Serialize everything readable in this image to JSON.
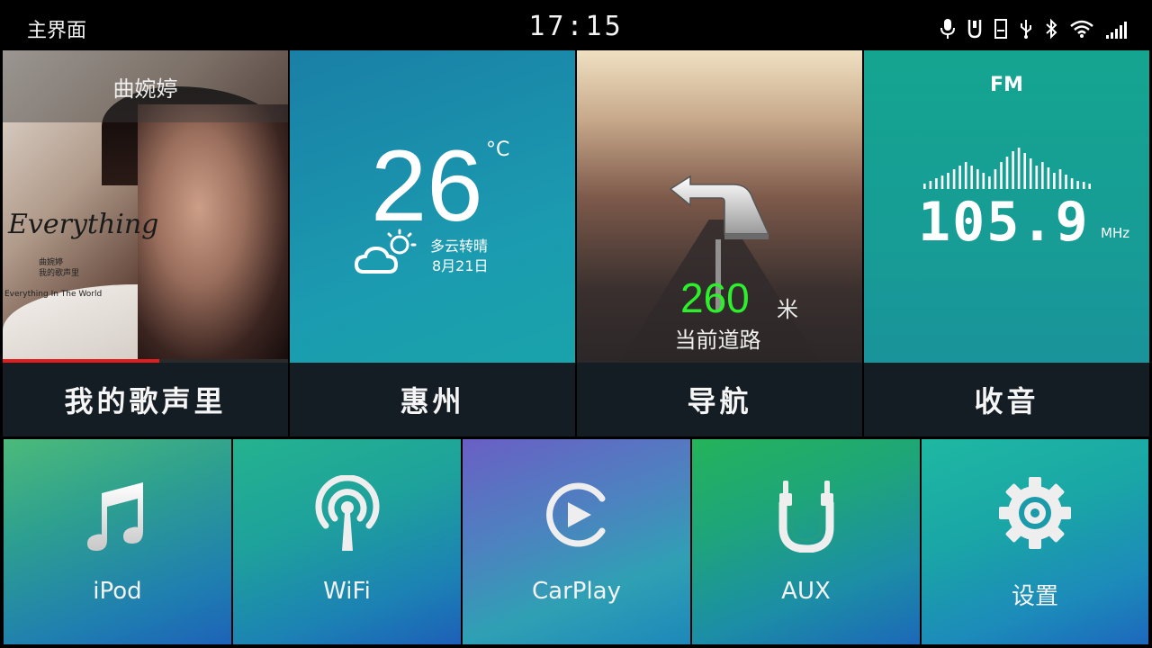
{
  "status_bar": {
    "title": "主界面",
    "clock": "17:15",
    "icons": [
      "microphone-icon",
      "usb-stick-icon",
      "sd-card-icon",
      "usb-icon",
      "bluetooth-icon",
      "wifi-icon",
      "signal-icon"
    ]
  },
  "music": {
    "artist": "曲婉婷",
    "album_script": "Everything",
    "album_small_artist": "曲婉婷",
    "album_small_title": "我的歌声里",
    "album_small_en": "Everything In The World",
    "song": "我的歌声里",
    "progress": 0.55,
    "progress_color": "#e11d1d"
  },
  "weather": {
    "temperature": "26",
    "unit": "°C",
    "condition": "多云转晴",
    "date": "8月21日",
    "city": "惠州",
    "icon": "cloud-sun-icon"
  },
  "navigation": {
    "distance": "260",
    "unit": "米",
    "road": "当前道路",
    "label": "导航",
    "distance_color": "#2cf02c",
    "icon": "turn-left-arrow-icon"
  },
  "radio": {
    "band": "FM",
    "frequency": "105.9",
    "unit": "MHz",
    "label": "收音"
  },
  "apps": [
    {
      "label": "iPod",
      "icon": "music-note-icon"
    },
    {
      "label": "WiFi",
      "icon": "wifi-antenna-icon"
    },
    {
      "label": "CarPlay",
      "icon": "play-circle-icon"
    },
    {
      "label": "AUX",
      "icon": "aux-jack-icon"
    },
    {
      "label": "设置",
      "icon": "gear-icon"
    }
  ]
}
